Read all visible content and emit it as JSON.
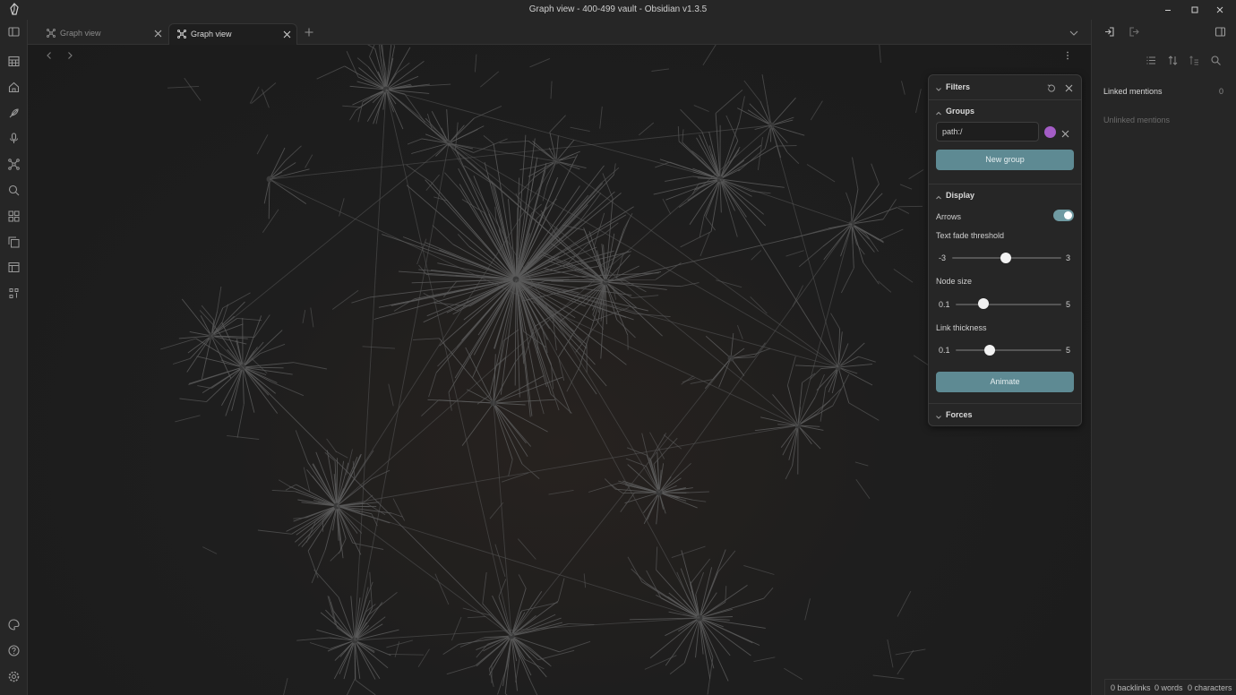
{
  "window": {
    "title": "Graph view - 400-499 vault - Obsidian v1.3.5"
  },
  "tabs": [
    {
      "label": "Graph view",
      "icon": "graph-icon",
      "active": false
    },
    {
      "label": "Graph view",
      "icon": "graph-icon",
      "active": true
    }
  ],
  "ribbon": {
    "icons": [
      "calendar-icon",
      "home-icon",
      "feather-icon",
      "microphone-icon",
      "graph-icon",
      "search-icon",
      "blocks-icon",
      "copy-icon",
      "template-icon",
      "workspace-icon",
      "palette-icon",
      "help-icon",
      "settings-icon"
    ]
  },
  "filters": {
    "title": "Filters",
    "groups": {
      "title": "Groups",
      "query": "path:/",
      "color": "#a45dc6",
      "new_group_label": "New group"
    },
    "display": {
      "title": "Display",
      "arrows_label": "Arrows",
      "arrows_on": true,
      "text_fade": {
        "label": "Text fade threshold",
        "min": "-3",
        "max": "3",
        "value": 0
      },
      "node_size": {
        "label": "Node size",
        "min": "0.1",
        "max": "5",
        "value": 1
      },
      "link_thickness": {
        "label": "Link thickness",
        "min": "0.1",
        "max": "5",
        "value": 1.2
      },
      "animate_label": "Animate"
    },
    "forces": {
      "title": "Forces"
    }
  },
  "backlinks": {
    "linked_label": "Linked mentions",
    "linked_count": "0",
    "unlinked_label": "Unlinked mentions"
  },
  "status": {
    "backlinks": "0 backlinks",
    "words": "0 words",
    "characters": "0 characters"
  },
  "colors": {
    "accent": "#5e8a93",
    "toggle": "#6f9aa2",
    "group_color": "#a45dc6",
    "graph_line": "#5a5a5a"
  }
}
